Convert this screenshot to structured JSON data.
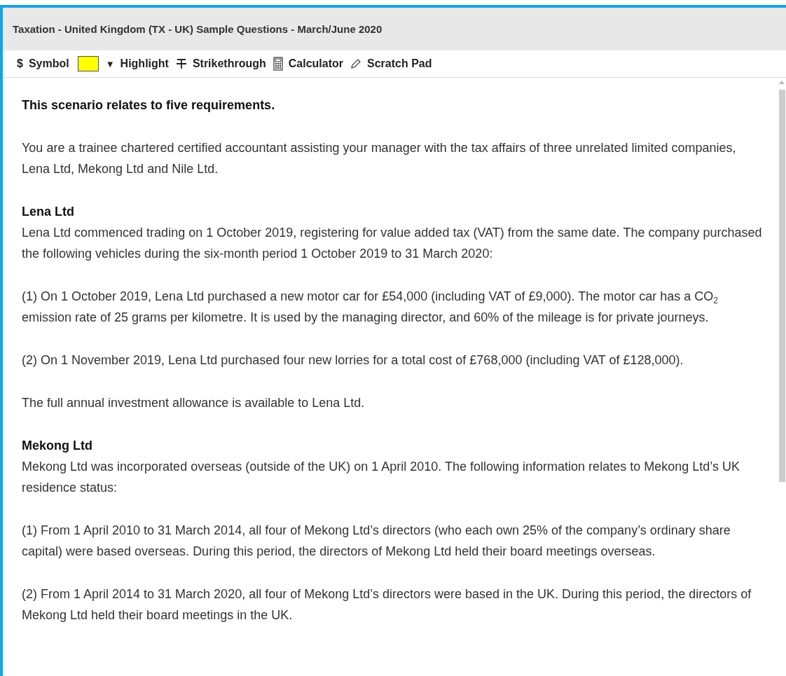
{
  "window": {
    "title": "Taxation - United Kingdom (TX - UK) Sample Questions - March/June 2020"
  },
  "toolbar": [
    {
      "kind": "symbol",
      "glyph": "$",
      "label": "Symbol"
    },
    {
      "kind": "swatch",
      "color": "#ffff00"
    },
    {
      "kind": "highlight",
      "glyph": "▼",
      "label": "Highlight"
    },
    {
      "kind": "strikethrough",
      "label": "Strikethrough"
    },
    {
      "kind": "calculator",
      "label": "Calculator"
    },
    {
      "kind": "scratchpad",
      "label": "Scratch Pad"
    }
  ],
  "content": [
    {
      "kind": "lead",
      "text": "This scenario relates to five requirements."
    },
    {
      "kind": "paragraph",
      "text": "You are a trainee chartered certified accountant assisting your manager with the tax affairs of three unrelated limited companies, Lena Ltd, Mekong Ltd and Nile Ltd."
    },
    {
      "kind": "subheading",
      "text": "Lena Ltd"
    },
    {
      "kind": "paragraph",
      "text": "Lena Ltd commenced trading on 1 October 2019, registering for value added tax (VAT) from the same date. The company purchased the following vehicles during the six-month period 1 October 2019 to 31 March 2020:"
    },
    {
      "kind": "paragraph",
      "text": "(1) On 1 October 2019, Lena Ltd purchased a new motor car for £54,000 (including VAT of £9,000). The motor car has a CO$_{2}$ emission rate of 25 grams per kilometre. It is used by the managing director, and 60% of the mileage is for private journeys."
    },
    {
      "kind": "paragraph",
      "text": "(2) On 1 November 2019, Lena Ltd purchased four new lorries for a total cost of £768,000 (including VAT of £128,000)."
    },
    {
      "kind": "paragraph",
      "text": "The full annual investment allowance is available to Lena Ltd."
    },
    {
      "kind": "subheading",
      "text": "Mekong Ltd"
    },
    {
      "kind": "paragraph",
      "text": "Mekong Ltd was incorporated overseas (outside of the UK) on 1 April 2010. The following information relates to Mekong Ltd’s UK residence status:"
    },
    {
      "kind": "paragraph",
      "text": "(1) From 1 April 2010 to 31 March 2014, all four of Mekong Ltd’s directors (who each own 25% of the company’s ordinary share capital) were based overseas. During this period, the directors of Mekong Ltd held their board meetings overseas."
    },
    {
      "kind": "paragraph",
      "text": "(2) From 1 April 2014 to 31 March 2020, all four of Mekong Ltd’s directors were based in the UK. During this period, the directors of Mekong Ltd held their board meetings in the UK."
    }
  ]
}
